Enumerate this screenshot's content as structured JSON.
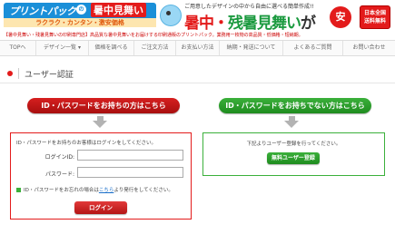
{
  "header": {
    "logo_text": "プリントパック",
    "logo_badge": "の",
    "logo_highlight": "暑中見舞い",
    "logo_tagline": "ラクラク・カンタン・激安価格",
    "promo_line": "ご用意したデザインの中から自由に選べる簡単作成!!",
    "promo_title_a": "暑中・",
    "promo_title_b": "残暑見舞い",
    "promo_title_c": "が",
    "promo_badge": "安い!",
    "ship_badge_line1": "日本全国",
    "ship_badge_line2": "送料無料"
  },
  "info_line": "【暑中見舞い・残暑見舞いの印刷専門店】高品質な暑中見舞いをお届けする印刷通販のプリントパック。業務用一枚物の高品質・低価格・短納期。",
  "nav": {
    "items": [
      {
        "label": "TOPへ"
      },
      {
        "label": "デザイン一覧 ▾"
      },
      {
        "label": "価格を調べる"
      },
      {
        "label": "ご注文方法"
      },
      {
        "label": "お支払い方法"
      },
      {
        "label": "納期・発送について"
      },
      {
        "label": "よくあるご質問"
      },
      {
        "label": "お問い合わせ"
      }
    ]
  },
  "page_title": "ユーザー認証",
  "login_section": {
    "heading": "ID・パスワードをお持ちの方はこちら",
    "intro": "ID・パスワードをお持ちのお客様はログインをしてください。",
    "login_id_label": "ログインID:",
    "login_id_value": "",
    "password_label": "パスワード:",
    "password_value": "",
    "note_prefix": "ID・パスワードをお忘れの場合は",
    "note_link": "こちら",
    "note_suffix": "より発行をしてください。",
    "login_button": "ログイン"
  },
  "register_section": {
    "heading": "ID・パスワードをお持ちでない方はこちら",
    "text": "下記よりユーザー登録を行ってください。",
    "register_button": "無料ユーザー登録"
  },
  "colors": {
    "brand_blue": "#1a8fd8",
    "accent_red": "#e31b1b",
    "accent_green": "#3bb03b"
  }
}
